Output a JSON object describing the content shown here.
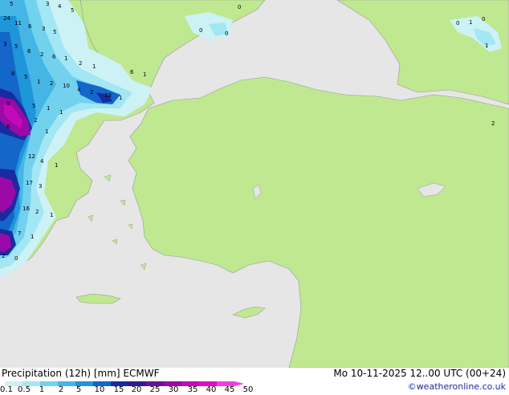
{
  "map": {
    "title": "Precipitation (12h) [mm] ECMWF",
    "datetime": "Mo 10-11-2025 12..00 UTC (00+24)",
    "credit": "©weatheronline.co.uk",
    "colors": {
      "sea": "#e6e6e6",
      "land": "#bfe890",
      "coast": "#9a9a9a"
    },
    "legend": {
      "labels": [
        "0.1",
        "0.5",
        "1",
        "2",
        "5",
        "10",
        "15",
        "20",
        "25",
        "30",
        "35",
        "40",
        "45",
        "50"
      ],
      "colors": [
        "#cdf2f6",
        "#a3e6f4",
        "#72d2ee",
        "#45b5e6",
        "#1f95da",
        "#1466c8",
        "#1a2aa0",
        "#321a8c",
        "#6a1296",
        "#9a0aa6",
        "#c40ab8",
        "#e00cc8",
        "#f040dc"
      ]
    },
    "precip_values": [
      "5",
      "3",
      "4",
      "5",
      "24",
      "11",
      "6",
      "3",
      "5",
      "3",
      "5",
      "6",
      "2",
      "6",
      "1",
      "2",
      "1",
      "8",
      "5",
      "1",
      "2",
      "10",
      "4",
      "2",
      "13",
      "1",
      "6",
      "1",
      "9",
      "5",
      "1",
      "1",
      "2",
      "1",
      "6",
      "12",
      "4",
      "1",
      "17",
      "3",
      "16",
      "2",
      "1",
      "7",
      "1",
      "2",
      "0",
      "0",
      "0",
      "0",
      "0",
      "1",
      "0",
      "1",
      "2"
    ]
  }
}
